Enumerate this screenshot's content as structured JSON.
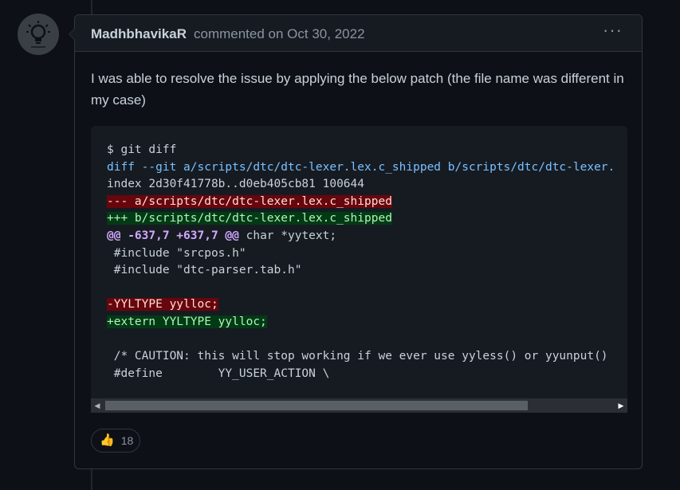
{
  "comment": {
    "author": "MadhbhavikaR",
    "meta": "commented on Oct 30, 2022",
    "menu_label": "···",
    "body": "I was able to resolve the issue by applying the below patch (the file name was different in my case)",
    "code_lines": [
      {
        "type": "plain",
        "text": "$ git diff"
      },
      {
        "type": "meta",
        "text": "diff --git a/scripts/dtc/dtc-lexer.lex.c_shipped b/scripts/dtc/dtc-lexer."
      },
      {
        "type": "plain",
        "text": "index 2d30f41778b..d0eb405cb81 100644"
      },
      {
        "type": "del",
        "text": "--- a/scripts/dtc/dtc-lexer.lex.c_shipped"
      },
      {
        "type": "add",
        "text": "+++ b/scripts/dtc/dtc-lexer.lex.c_shipped"
      },
      {
        "type": "hunk",
        "hunk": "@@ -637,7 +637,7 @@",
        "text": " char *yytext;"
      },
      {
        "type": "plain",
        "text": " #include \"srcpos.h\""
      },
      {
        "type": "plain",
        "text": " #include \"dtc-parser.tab.h\""
      },
      {
        "type": "plain",
        "text": ""
      },
      {
        "type": "del",
        "text": "-YYLTYPE yylloc;"
      },
      {
        "type": "add",
        "text": "+extern YYLTYPE yylloc;"
      },
      {
        "type": "plain",
        "text": ""
      },
      {
        "type": "plain",
        "text": " /* CAUTION: this will stop working if we ever use yyless() or yyunput()"
      },
      {
        "type": "plain",
        "text": " #define        YY_USER_ACTION \\"
      }
    ],
    "scroll_left": "◀",
    "scroll_right": "▶",
    "reaction": {
      "emoji": "👍",
      "count": "18"
    }
  },
  "colors": {
    "background": "#0d1117",
    "header": "#161b22",
    "border": "#30363d",
    "diff_meta": "#79c0ff",
    "diff_del_bg": "#67060c",
    "diff_add_bg": "#033a16",
    "diff_hunk": "#d2a8ff"
  }
}
